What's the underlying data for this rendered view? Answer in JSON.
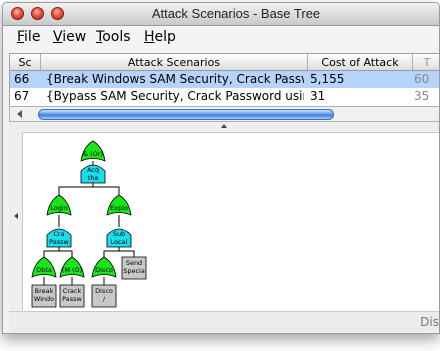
{
  "window": {
    "title": "Attack Scenarios - Base Tree"
  },
  "menu": [
    {
      "label": "File",
      "key": "F",
      "rest": "ile"
    },
    {
      "label": "View",
      "key": "V",
      "rest": "iew"
    },
    {
      "label": "Tools",
      "key": "T",
      "rest": "ools"
    },
    {
      "label": "Help",
      "key": "H",
      "rest": "elp"
    }
  ],
  "table": {
    "headers": [
      "Sc",
      "Attack Scenarios",
      "Cost of Attack",
      "T"
    ],
    "rows": [
      {
        "num": "66",
        "scenario": "{Break Windows SAM Security, Crack Passw...",
        "cost": "5,155",
        "extra": "60",
        "selected": true
      },
      {
        "num": "67",
        "scenario": "{Bypass SAM Security, Crack Password usin...",
        "cost": "31",
        "extra": "35",
        "selected": false
      }
    ]
  },
  "tree": {
    "nodes": [
      {
        "id": "root",
        "lines": [
          "& (Or)"
        ],
        "kind": "or"
      },
      {
        "id": "acq",
        "lines": [
          "Acq",
          "the"
        ],
        "kind": "and"
      },
      {
        "id": "login",
        "lines": [
          "Login"
        ],
        "kind": "or"
      },
      {
        "id": "exploit",
        "lines": [
          "Explo"
        ],
        "kind": "or"
      },
      {
        "id": "crack",
        "lines": [
          "Cra",
          "Passw"
        ],
        "kind": "and"
      },
      {
        "id": "sub",
        "lines": [
          "Sub",
          "Local"
        ],
        "kind": "and"
      },
      {
        "id": "obta",
        "lines": [
          "Obta"
        ],
        "kind": "or"
      },
      {
        "id": "mor",
        "lines": [
          "(M (O)"
        ],
        "kind": "or"
      },
      {
        "id": "disco",
        "lines": [
          "Disco"
        ],
        "kind": "or"
      },
      {
        "id": "send",
        "lines": [
          "Send",
          "Specia"
        ],
        "kind": "leaf"
      },
      {
        "id": "break",
        "lines": [
          "Break",
          "Windo"
        ],
        "kind": "leaf"
      },
      {
        "id": "crackleaf",
        "lines": [
          "Crack",
          "Passw"
        ],
        "kind": "leaf"
      },
      {
        "id": "discoleaf",
        "lines": [
          "Disco",
          "/"
        ],
        "kind": "leaf"
      }
    ]
  },
  "status": {
    "text": "Dis"
  },
  "colors": {
    "or": "#19e619",
    "and": "#19dcec",
    "leaf": "#c8c8c8",
    "selection": "#b5d4fb"
  }
}
